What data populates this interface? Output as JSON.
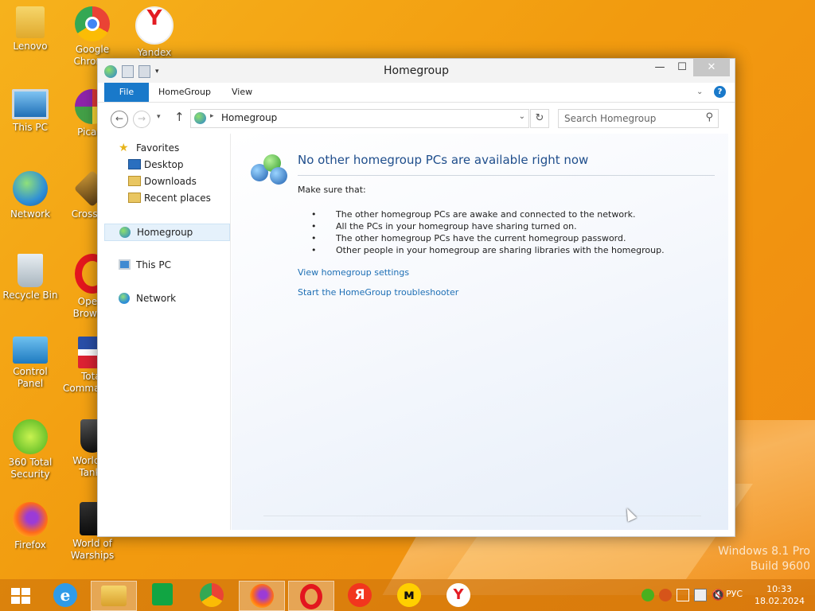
{
  "desktop": {
    "icons": [
      {
        "label": "Lenovo"
      },
      {
        "label": "Google Chrome"
      },
      {
        "label": "Yandex"
      },
      {
        "label": "This PC"
      },
      {
        "label": "Picasa"
      },
      {
        "label": "Network"
      },
      {
        "label": "Crossout"
      },
      {
        "label": "Recycle Bin"
      },
      {
        "label": "Opera Browser"
      },
      {
        "label": "Control Panel"
      },
      {
        "label": "Total Commander"
      },
      {
        "label": "360 Total Security"
      },
      {
        "label": "World of Tanks"
      },
      {
        "label": "Firefox"
      },
      {
        "label": "World of Warships"
      }
    ],
    "watermark": {
      "line1": "Windows 8.1 Pro",
      "line2": "Build 9600"
    }
  },
  "window": {
    "title": "Homegroup",
    "controls": {
      "minimize": "—",
      "maximize": "☐",
      "close": "✕"
    },
    "ribbon": {
      "tabs": [
        "File",
        "HomeGroup",
        "View"
      ]
    },
    "address": {
      "path": "Homegroup",
      "search_placeholder": "Search Homegroup"
    },
    "nav": {
      "favorites": "Favorites",
      "desktop": "Desktop",
      "downloads": "Downloads",
      "recent": "Recent places",
      "homegroup": "Homegroup",
      "thispc": "This PC",
      "network": "Network"
    },
    "content": {
      "heading": "No other homegroup PCs are available right now",
      "intro": "Make sure that:",
      "bullets": [
        "The other homegroup PCs are awake and connected to the network.",
        "All the PCs in your homegroup have sharing turned on.",
        "The other homegroup PCs have the current homegroup password.",
        "Other people in your homegroup are sharing libraries with the homegroup."
      ],
      "link1": "View homegroup settings",
      "link2": "Start the HomeGroup troubleshooter"
    }
  },
  "taskbar": {
    "lang": "РУС",
    "time": "10:33",
    "date": "18.02.2024"
  },
  "colors": {
    "accent": "#1979ca",
    "link": "#1e6fb5",
    "heading": "#1f4e8c"
  }
}
